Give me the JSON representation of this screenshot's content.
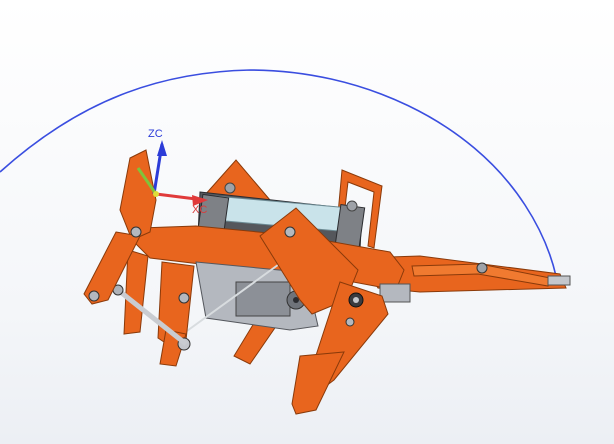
{
  "viewport": {
    "background_top": "#ffffff",
    "background_bottom": "#eceff4"
  },
  "triad": {
    "z_label": "ZC",
    "x_label": "XC",
    "z_color": "#2c3cd8",
    "x_color": "#e03a3a",
    "y_color": "#7fc43a"
  },
  "trajectory": {
    "icon": "arc-path",
    "color": "#3a4ee0"
  },
  "model": {
    "primary_color": "#e8651e",
    "edge_color": "#8a3a0a",
    "metal_color": "#b4b8bf",
    "motor_color": "#8c9097",
    "shaft_color": "#c9e3ea"
  }
}
